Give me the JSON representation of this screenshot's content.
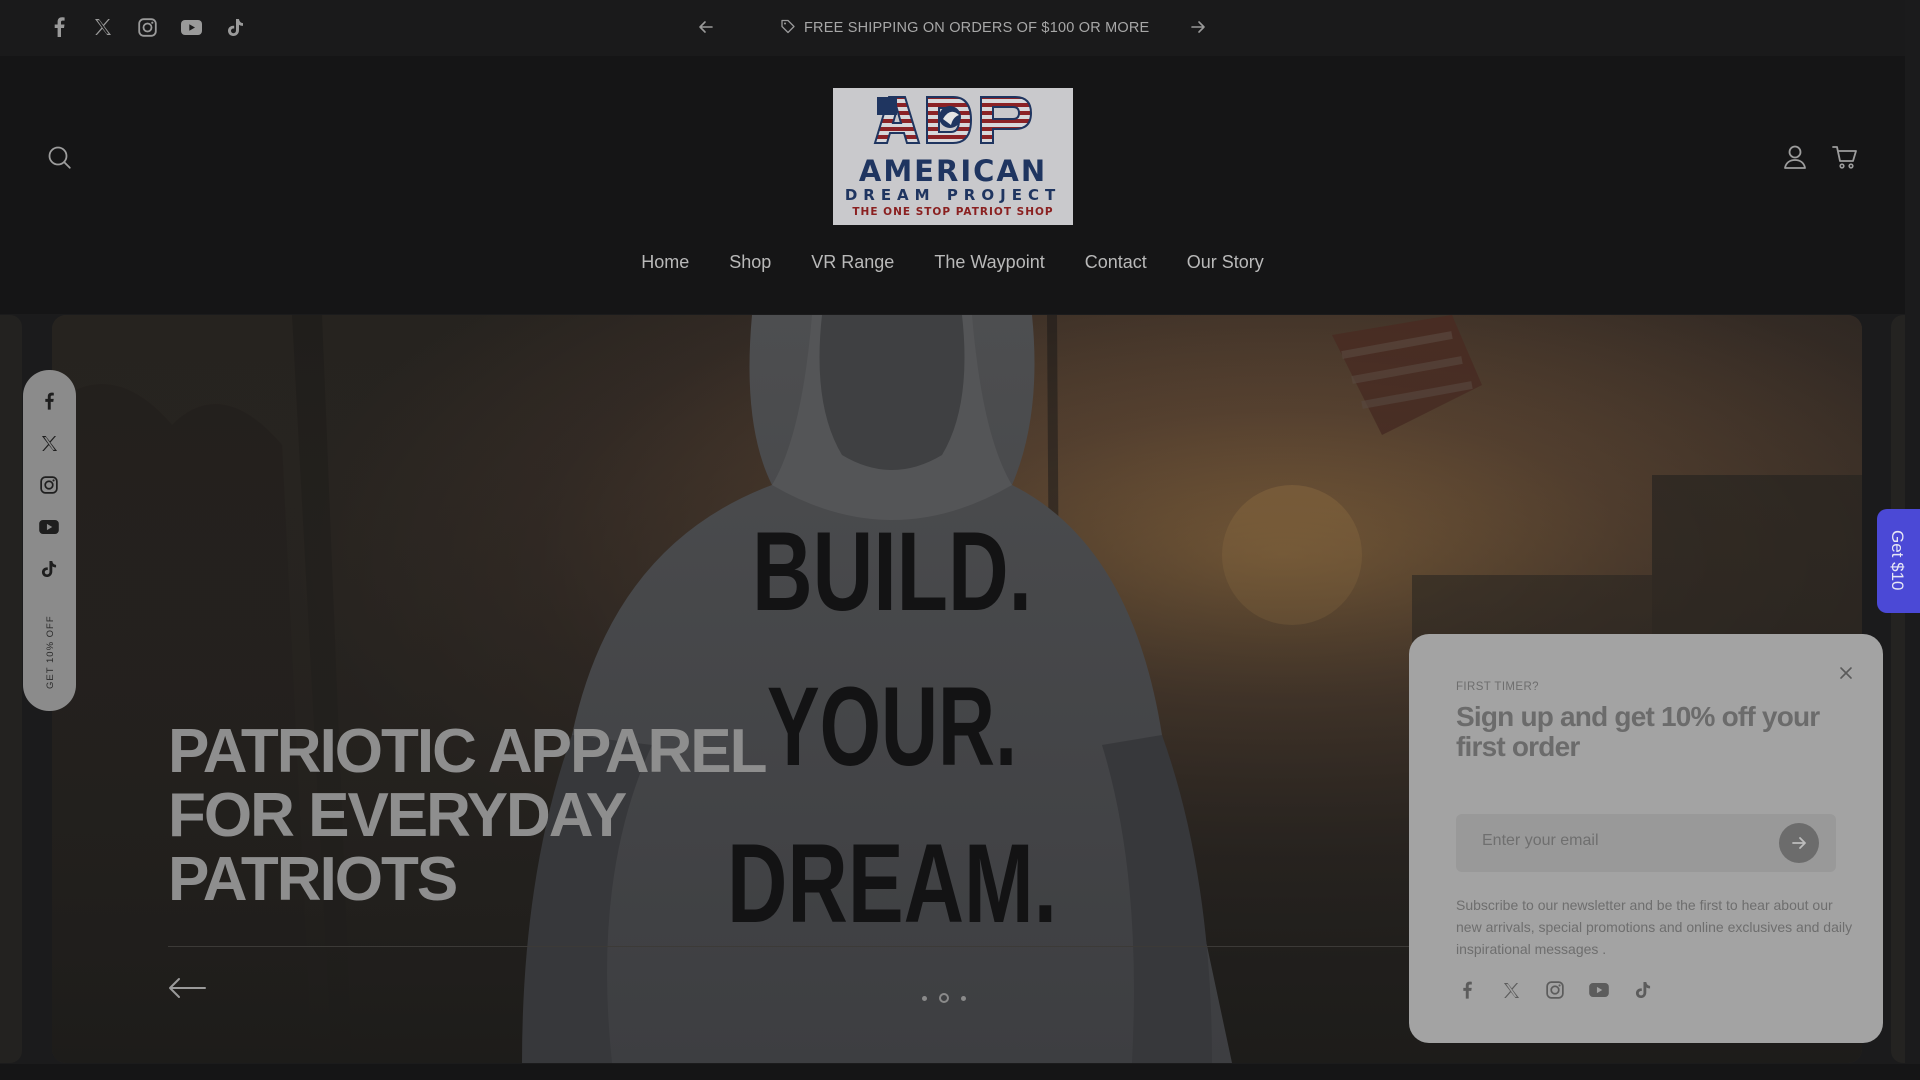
{
  "announcement": {
    "text": "FREE SHIPPING ON ORDERS OF $100 OR MORE",
    "prev_icon": "arrow-left-icon",
    "next_icon": "arrow-right-icon",
    "tag_icon": "tag-icon"
  },
  "top_socials": [
    "facebook-icon",
    "x-twitter-icon",
    "instagram-icon",
    "youtube-icon",
    "tiktok-icon"
  ],
  "header": {
    "logo": {
      "letters": "ADP",
      "name": "AMERICAN",
      "sub": "DREAM PROJECT",
      "tagline": "THE ONE STOP PATRIOT SHOP"
    },
    "icons": {
      "search": "search-icon",
      "account": "user-icon",
      "cart": "cart-icon"
    }
  },
  "nav": {
    "items": [
      {
        "label": "Home"
      },
      {
        "label": "Shop"
      },
      {
        "label": "VR Range"
      },
      {
        "label": "The Waypoint"
      },
      {
        "label": "Contact"
      },
      {
        "label": "Our Story"
      }
    ]
  },
  "hero": {
    "hoodie_lines": [
      "BUILD.",
      "YOUR.",
      "DREAM."
    ],
    "title_lines": [
      "PATRIOTIC APPAREL",
      "FOR EVERYDAY",
      "PATRIOTS"
    ],
    "slides_count": 3,
    "active_slide": 2
  },
  "rail": {
    "label": "GET 10% OFF"
  },
  "get10": {
    "label": "Get $10"
  },
  "popup": {
    "eyebrow": "FIRST TIMER?",
    "headline": "Sign up and get 10% off your first order",
    "email_placeholder": "Enter your email",
    "description": "Subscribe to our newsletter and be the first to hear about our new arrivals, special promotions and online exclusives and daily inspirational messages ."
  },
  "colors": {
    "background": "#1b1b1c",
    "get10_accent": "#4b49d6",
    "logo_navy": "#1f3560",
    "logo_red": "#8a2020"
  }
}
